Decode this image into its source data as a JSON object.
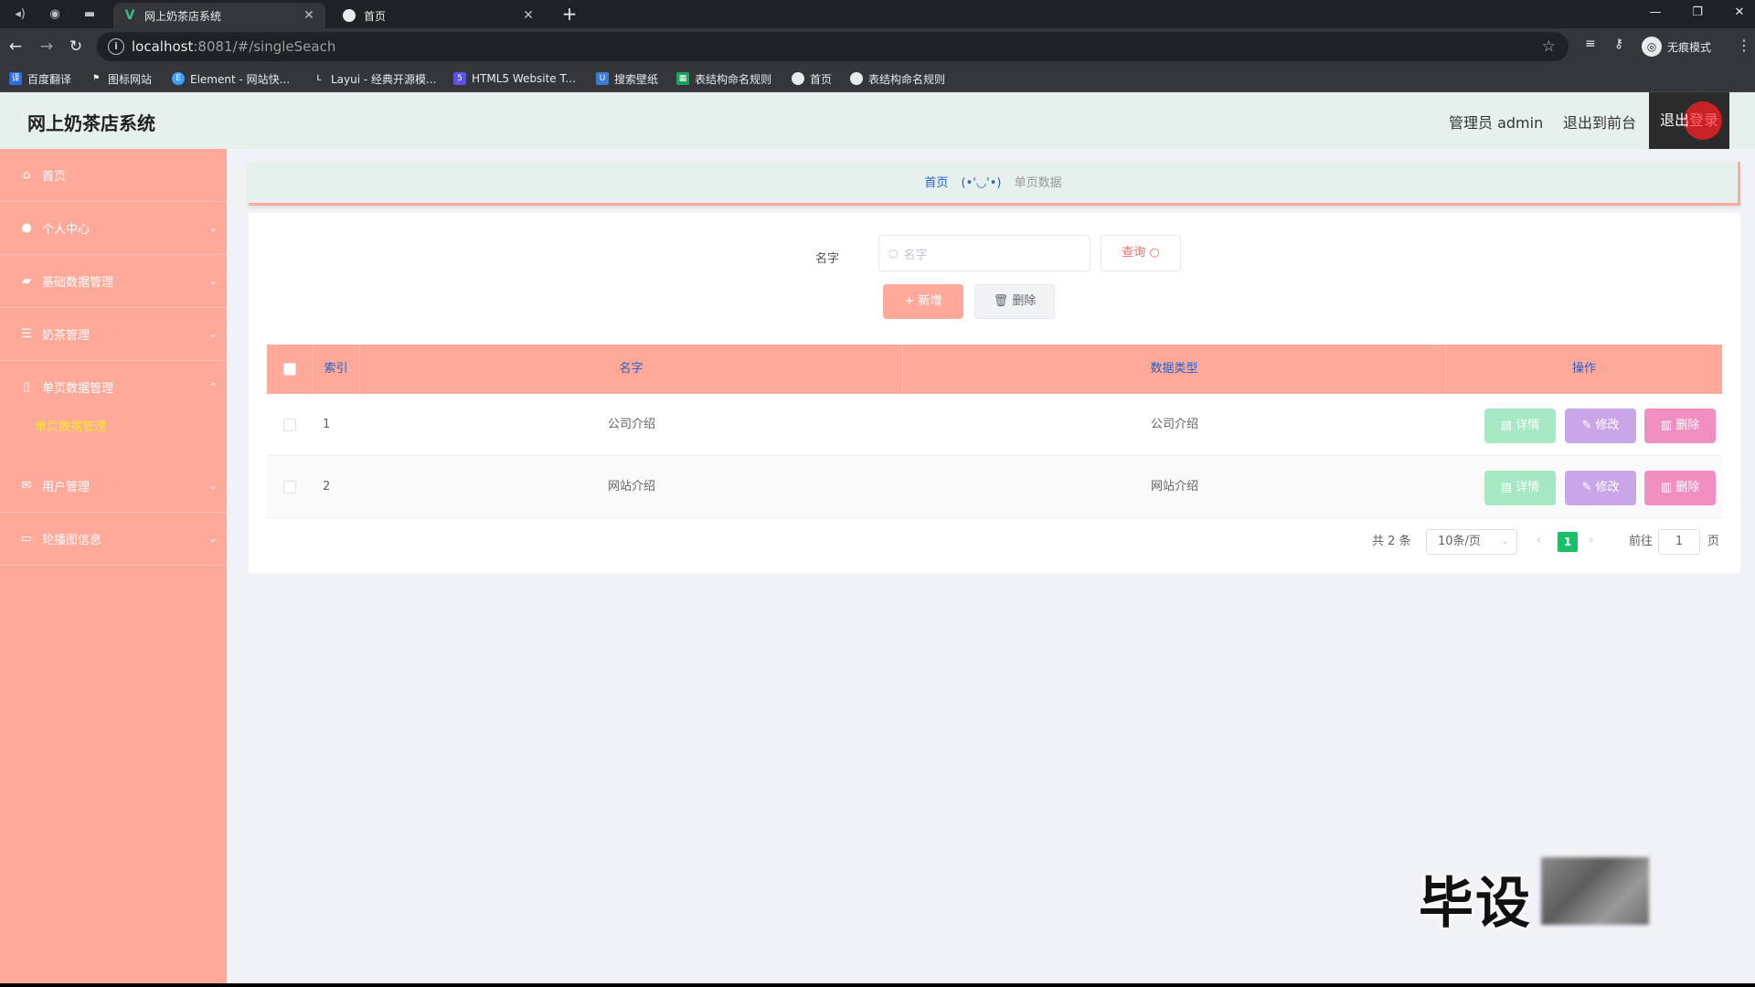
{
  "browser": {
    "tabs": [
      {
        "title": "网上奶茶店系统",
        "active": true,
        "icon": "vue-logo-icon"
      },
      {
        "title": "首页",
        "active": false,
        "icon": "globe-icon"
      }
    ],
    "url_host": "localhost",
    "url_path": ":8081/#/singleSeach",
    "profile_label": "无痕模式",
    "bookmarks": [
      {
        "label": "百度翻译",
        "icon": "translate-icon",
        "color": "#2b6de5"
      },
      {
        "label": "图标网站",
        "icon": "flag-icon",
        "color": "#ffffff"
      },
      {
        "label": "Element - 网站快...",
        "icon": "element-icon",
        "color": "#409eff"
      },
      {
        "label": "Layui - 经典开源模...",
        "icon": "layui-icon",
        "color": "#ffffff"
      },
      {
        "label": "HTML5 Website T...",
        "icon": "html5-icon",
        "color": "#5b52e5"
      },
      {
        "label": "搜索壁纸",
        "icon": "wallpaper-icon",
        "color": "#3a7bd5"
      },
      {
        "label": "表结构命名规则",
        "icon": "sheet-icon",
        "color": "#1aa260"
      },
      {
        "label": "首页",
        "icon": "globe-icon",
        "color": "#ffffff"
      },
      {
        "label": "表结构命名规则",
        "icon": "globe-icon",
        "color": "#ffffff"
      }
    ]
  },
  "header": {
    "title": "网上奶茶店系统",
    "admin_label": "管理员 admin",
    "back_label": "退出到前台",
    "logout_label_a": "退出",
    "logout_label_b": "登录"
  },
  "sidebar": {
    "items": [
      {
        "label": "首页",
        "icon": "home-icon",
        "arrow": ""
      },
      {
        "label": "个人中心",
        "icon": "user-icon",
        "arrow": "⌄"
      },
      {
        "label": "基础数据管理",
        "icon": "briefcase-icon",
        "arrow": "⌄"
      },
      {
        "label": "奶茶管理",
        "icon": "list-icon",
        "arrow": "⌄"
      },
      {
        "label": "单页数据管理",
        "icon": "phone-icon",
        "arrow": "⌃"
      },
      {
        "label": "用户管理",
        "icon": "mail-icon",
        "arrow": "⌄"
      },
      {
        "label": "轮播图信息",
        "icon": "chat-icon",
        "arrow": "⌄"
      }
    ],
    "sub_item": "单页数据管理"
  },
  "breadcrumb": {
    "home": "首页",
    "sep": "(•'◡'•)",
    "current": "单页数据"
  },
  "search": {
    "label": "名字",
    "placeholder": "名字",
    "query_label": "查询"
  },
  "actions": {
    "add_label": "新增",
    "delete_label": "删除"
  },
  "table": {
    "headers": {
      "index": "索引",
      "name": "名字",
      "type": "数据类型",
      "ops": "操作"
    },
    "rows": [
      {
        "index": "1",
        "name": "公司介绍",
        "type": "公司介绍"
      },
      {
        "index": "2",
        "name": "网站介绍",
        "type": "网站介绍"
      }
    ],
    "op_labels": {
      "detail": "详情",
      "edit": "修改",
      "delete": "删除"
    }
  },
  "pagination": {
    "total": "共 2 条",
    "page_size": "10条/页",
    "current_page": "1",
    "goto_label": "前往",
    "goto_value": "1",
    "page_suffix": "页"
  },
  "watermark": {
    "text": "毕设"
  },
  "colors": {
    "accent": "#ffa99a",
    "header_bg": "#e6f1ee",
    "link": "#2660c8",
    "success": "#19be6b"
  }
}
